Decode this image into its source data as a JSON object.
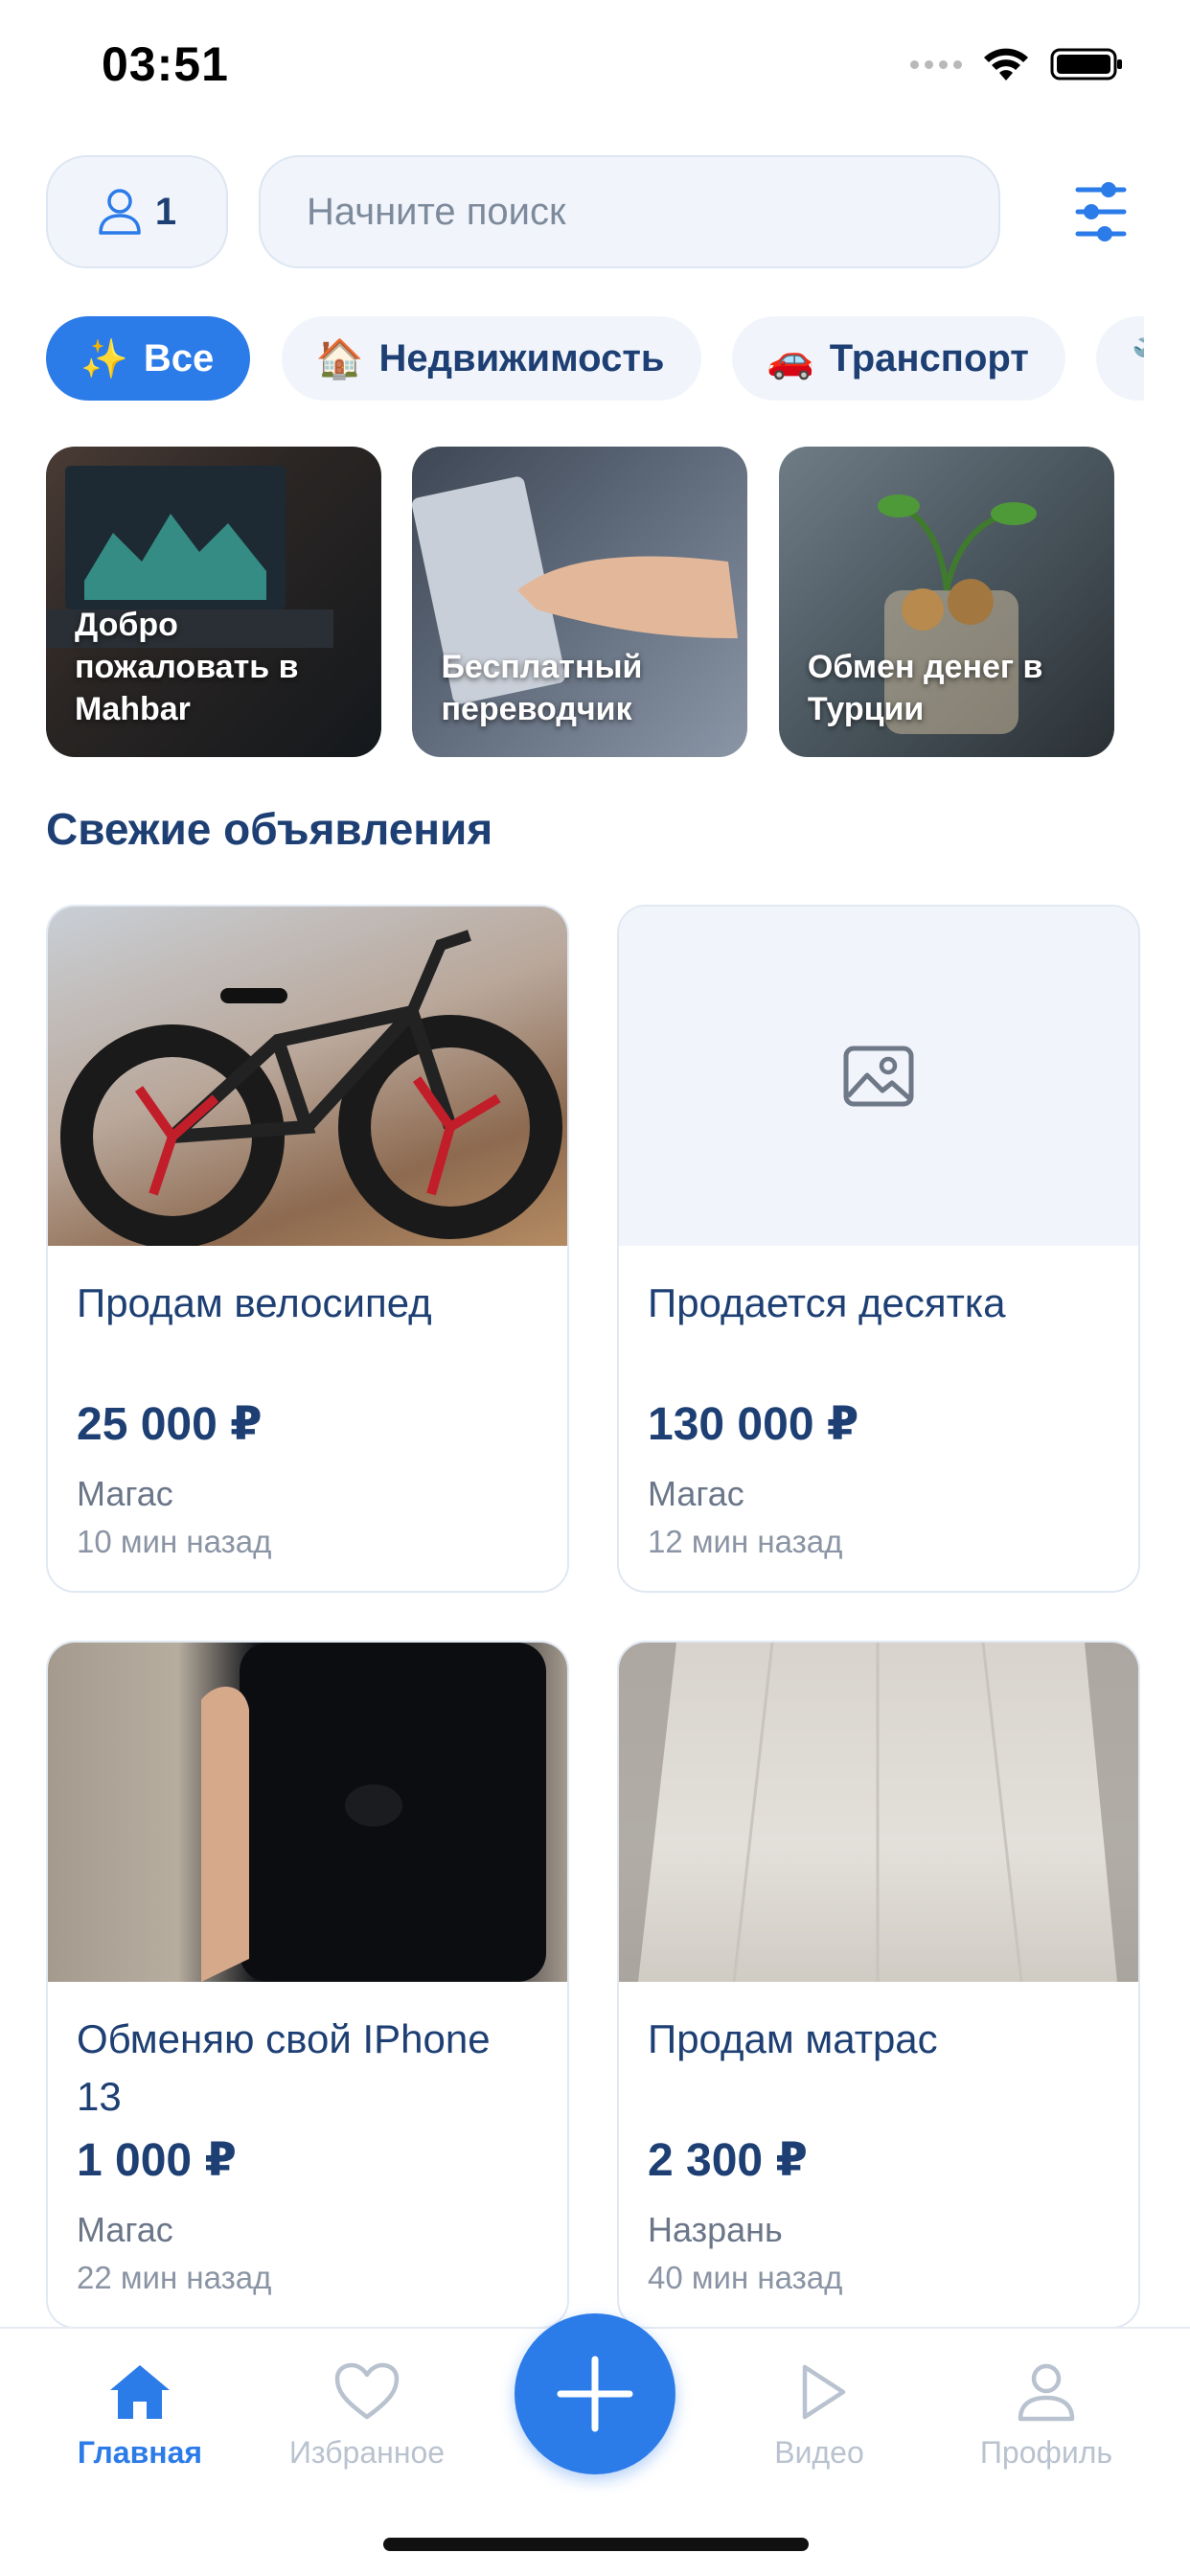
{
  "status_bar": {
    "time": "03:51"
  },
  "header": {
    "user_count": "1",
    "search_placeholder": "Начните поиск"
  },
  "chips": [
    {
      "emoji": "✨",
      "label": "Все"
    },
    {
      "emoji": "🏠",
      "label": "Недвижимость"
    },
    {
      "emoji": "🚗",
      "label": "Транспорт"
    }
  ],
  "stories": [
    {
      "text": "Добро пожаловать в Mahbar"
    },
    {
      "text": "Бесплатный переводчик"
    },
    {
      "text": "Обмен денег в Турции"
    }
  ],
  "section_title": "Свежие объявления",
  "listings": [
    {
      "title": "Продам велосипед",
      "price": "25 000 ₽",
      "city": "Магас",
      "time": "10 мин назад"
    },
    {
      "title": "Продается десятка",
      "price": "130 000 ₽",
      "city": "Магас",
      "time": "12 мин назад"
    },
    {
      "title": "Обменяю свой IPhone 13",
      "price": "1 000 ₽",
      "city": "Магас",
      "time": "22 мин назад"
    },
    {
      "title": "Продам матрас",
      "price": "2 300 ₽",
      "city": "Назрань",
      "time": "40 мин назад"
    }
  ],
  "tabbar": {
    "home": "Главная",
    "favorites": "Избранное",
    "video": "Видео",
    "profile": "Профиль"
  },
  "colors": {
    "accent": "#2b7be9",
    "text": "#1d3f73",
    "muted": "#b9c2cf"
  }
}
